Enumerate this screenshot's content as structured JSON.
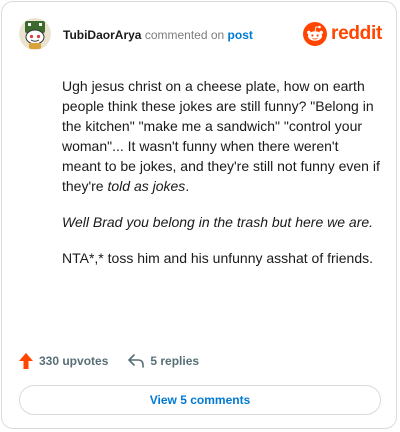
{
  "header": {
    "username": "TubiDaorArya",
    "action_text": "commented on",
    "target_link": "post",
    "brand": "reddit",
    "avatar_icon": "snoo-avatar-icon",
    "brand_icon": "reddit-snoo-icon"
  },
  "comment": {
    "p1_main": "Ugh jesus christ on a cheese plate, how on earth people think these jokes are still funny? \"Belong in the kitchen\" \"make me a sandwich\" \"control your woman\"... It wasn't funny when there weren't meant to be jokes, and they're still not funny even if they're ",
    "p1_italic": "told as jokes",
    "p1_end": ".",
    "p2_italic": "Well Brad you belong in the trash but here we are.",
    "p3": "NTA*,* toss him and his unfunny asshat of friends."
  },
  "actions": {
    "upvotes": "330 upvotes",
    "replies": "5 replies",
    "upvote_icon": "upvote-arrow-icon",
    "reply_icon": "reply-icon"
  },
  "footer": {
    "view_comments": "View 5 comments"
  },
  "colors": {
    "brand": "#ff4500",
    "link": "#0079d3",
    "border": "#d9dbdc"
  }
}
